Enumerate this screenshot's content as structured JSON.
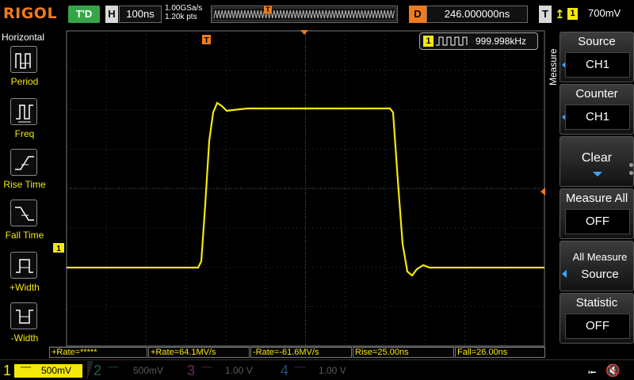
{
  "header": {
    "brand": "RIGOL",
    "run_state": "T'D",
    "timebase_letter": "H",
    "timebase": "100ns",
    "sample_rate": "1.00GSa/s",
    "memory_depth": "1.20k pts",
    "trigger_marker": "T",
    "delay_letter": "D",
    "delay": "246.000000ns",
    "trigger_letter": "T",
    "trigger_edge_icon": "rising-edge-icon",
    "trigger_source": "1",
    "trigger_level": "700mV"
  },
  "left_panel": {
    "title": "Horizontal",
    "buttons": [
      {
        "label": "Period",
        "icon": "period-icon"
      },
      {
        "label": "Freq",
        "icon": "frequency-icon"
      },
      {
        "label": "Rise Time",
        "icon": "rise-time-icon"
      },
      {
        "label": "Fall Time",
        "icon": "fall-time-icon"
      },
      {
        "label": "+Width",
        "icon": "positive-width-icon"
      },
      {
        "label": "-Width",
        "icon": "negative-width-icon"
      }
    ]
  },
  "scope": {
    "trigger_top_marker": "T",
    "channel_marker": "1",
    "counter_channel": "1",
    "counter_value": "999.998kHz",
    "colors": {
      "ch1": "#f5e80a",
      "trigger": "#f07b1c",
      "grid": "#3a3a3a",
      "accent": "#3aa7ff"
    }
  },
  "right_panel": {
    "side_label": "Measure",
    "source": {
      "label": "Source",
      "value": "CH1"
    },
    "counter": {
      "label": "Counter",
      "value": "CH1"
    },
    "clear": {
      "label": "Clear"
    },
    "measure_all": {
      "label": "Measure All",
      "value": "OFF"
    },
    "all_measure_source": {
      "line1": "All Measure",
      "line2": "Source"
    },
    "statistic": {
      "label": "Statistic",
      "value": "OFF"
    }
  },
  "measurements": [
    "+Rate=*****",
    "+Rate=64.1MV/s",
    "-Rate=-61.6MV/s",
    "Rise=25.00ns",
    "Fall=26.00ns"
  ],
  "bottom": {
    "channels": [
      {
        "num": "1",
        "scale": "500mV",
        "active": true
      },
      {
        "num": "2",
        "scale": "500mV",
        "active": false
      },
      {
        "num": "3",
        "scale": "1.00 V",
        "active": false
      },
      {
        "num": "4",
        "scale": "1.00 V",
        "active": false
      }
    ],
    "usb_icon": "usb-icon",
    "speaker_icon": "speaker-muted-icon"
  }
}
